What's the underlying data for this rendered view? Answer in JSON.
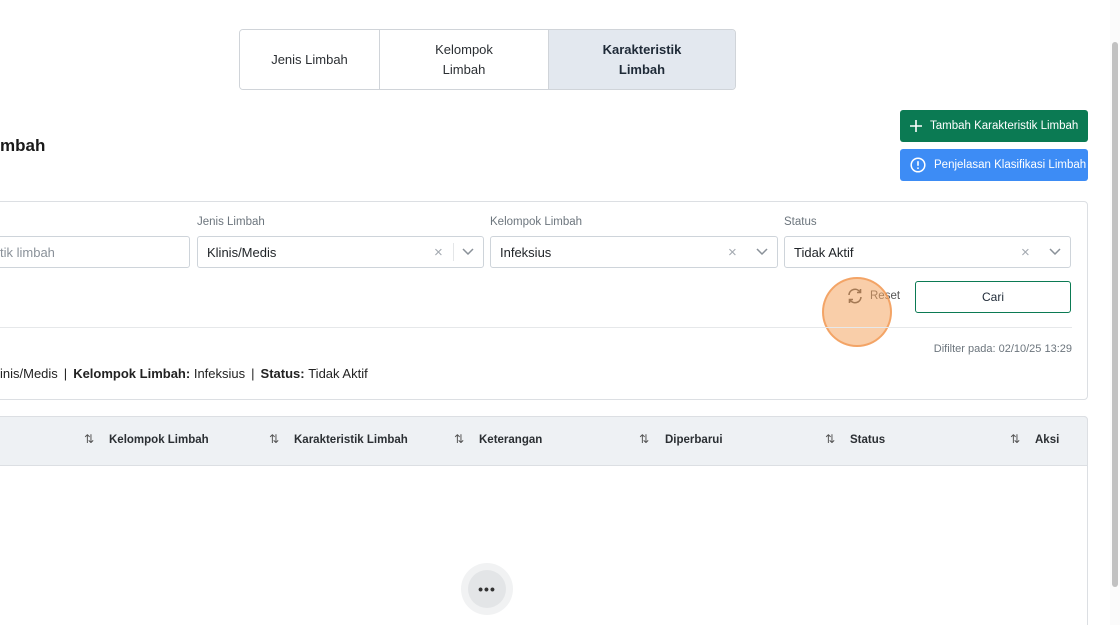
{
  "tabs": [
    {
      "label": "Jenis Limbah",
      "active": false
    },
    {
      "label": "Kelompok Limbah",
      "active": false
    },
    {
      "label": "Karakteristik Limbah",
      "active": true
    }
  ],
  "page_title": "mbah",
  "actions": {
    "add_label": "Tambah Karakteristik Limbah",
    "info_label": "Penjelasan Klasifikasi Limbah"
  },
  "filters": {
    "search_placeholder": "tik limbah",
    "jenis": {
      "label": "Jenis Limbah",
      "value": "Klinis/Medis"
    },
    "kelompok": {
      "label": "Kelompok Limbah",
      "value": "Infeksius"
    },
    "status": {
      "label": "Status",
      "value": "Tidak Aktif"
    },
    "clear_glyph": "×",
    "reset_label": "Reset",
    "search_button": "Cari"
  },
  "filter_summary": {
    "filtered_at": "Difilter pada: 02/10/25 13:29",
    "jenis_value": "inis/Medis",
    "kelompok_label": "Kelompok Limbah:",
    "kelompok_value": "Infeksius",
    "status_label": "Status:",
    "status_value": "Tidak Aktif",
    "separator": "|"
  },
  "table": {
    "columns": [
      "Kelompok Limbah",
      "Karakteristik Limbah",
      "Keterangan",
      "Diperbarui",
      "Status",
      "Aksi"
    ],
    "sort_glyph": "⇅",
    "loading_glyph": "•••"
  },
  "colors": {
    "primary_green": "#0b7a53",
    "info_blue": "#3d8cf5",
    "active_tab_bg": "#e3e8ef",
    "click_highlight": "#f4a662"
  }
}
